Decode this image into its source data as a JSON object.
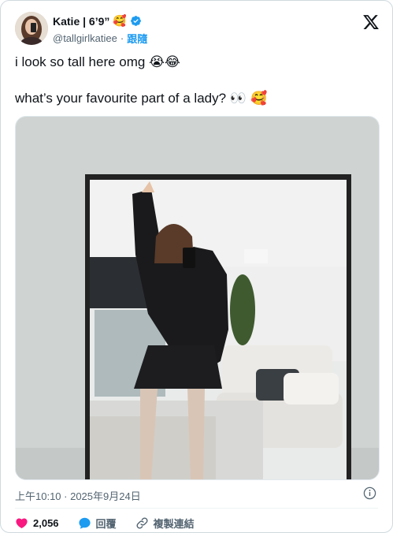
{
  "author": {
    "display_name": "Katie | 6’9”",
    "name_emoji": "🥰",
    "handle": "@tallgirlkatiee",
    "separator": "·",
    "follow_label": "跟隨"
  },
  "tweet": {
    "line1": "i look so tall here omg",
    "line1_emoji": "😭😂",
    "line2": "what’s your favourite part of a lady? ",
    "line2_emoji": "👀 🥰"
  },
  "timestamp": "上午10:10 · 2025年9月24日",
  "actions": {
    "like_count": "2,056",
    "reply_label": "回覆",
    "copy_link_label": "複製連結"
  },
  "colors": {
    "accent": "#1d9bf0",
    "like": "#f91880",
    "text": "#0f1419",
    "muted": "#536471"
  },
  "icons": {
    "verified": "verified-badge-icon",
    "brand": "x-logo-icon",
    "info": "info-icon",
    "like": "heart-icon",
    "reply": "speech-bubble-icon",
    "link": "link-icon"
  }
}
